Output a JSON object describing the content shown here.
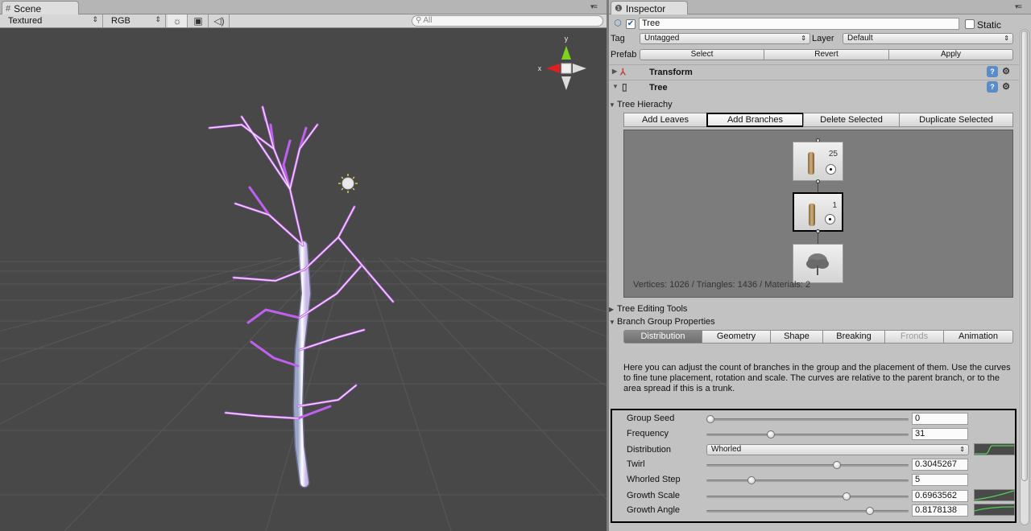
{
  "scene": {
    "tab_label": "Scene",
    "tab_icon": "grid-icon",
    "toolbar": {
      "render_mode": "Textured",
      "color_mode": "RGB",
      "search_placeholder": "All"
    }
  },
  "inspector": {
    "tab_label": "Inspector",
    "tab_icon": "info-icon",
    "object": {
      "name": "Tree",
      "active": true,
      "static_label": "Static",
      "static": false,
      "tag_label": "Tag",
      "tag_value": "Untagged",
      "layer_label": "Layer",
      "layer_value": "Default",
      "prefab_label": "Prefab",
      "prefab_buttons": [
        "Select",
        "Revert",
        "Apply"
      ]
    },
    "components": [
      {
        "name": "Transform",
        "icon": "transform-axes-icon",
        "expanded": false
      },
      {
        "name": "Tree",
        "icon": "document-icon",
        "expanded": true
      }
    ],
    "tree_hierarchy": {
      "label": "Tree Hierachy",
      "buttons": [
        "Add Leaves",
        "Add Branches",
        "Delete Selected",
        "Duplicate Selected"
      ],
      "selected_button": "Add Branches",
      "nodes": [
        {
          "count": "25",
          "kind": "branch"
        },
        {
          "count": "1",
          "kind": "branch",
          "selected": true
        },
        {
          "count": "",
          "kind": "tree-root"
        }
      ],
      "stats": "Vertices: 1026 / Triangles: 1436 / Materials: 2"
    },
    "tree_editing_tools": {
      "label": "Tree Editing Tools"
    },
    "branch_group": {
      "label": "Branch Group Properties",
      "tabs": [
        {
          "label": "Distribution",
          "active": true
        },
        {
          "label": "Geometry"
        },
        {
          "label": "Shape"
        },
        {
          "label": "Breaking"
        },
        {
          "label": "Fronds",
          "disabled": true
        },
        {
          "label": "Animation"
        }
      ],
      "help_text": "Here you can adjust the count of branches in the group and the placement of them. Use the curves to fine tune placement, rotation and scale. The curves are relative to the parent branch, or to the area spread if this is a trunk.",
      "properties": [
        {
          "label": "Group Seed",
          "value": "0",
          "slider": 0.0
        },
        {
          "label": "Frequency",
          "value": "31",
          "slider": 0.31
        },
        {
          "label": "Distribution",
          "value": "Whorled",
          "dropdown": true,
          "curve": true
        },
        {
          "label": "Twirl",
          "value": "0.3045267",
          "slider": 0.65
        },
        {
          "label": "Whorled Step",
          "value": "5",
          "slider": 0.21
        },
        {
          "label": "Growth Scale",
          "value": "0.6963562",
          "slider": 0.7,
          "curve": true
        },
        {
          "label": "Growth Angle",
          "value": "0.8178138",
          "slider": 0.82,
          "curve": true
        }
      ]
    }
  },
  "colors": {
    "scene_bg": "#484848",
    "grid": "#5a5a5a",
    "branch_highlight": "#b050e8",
    "gizmo_y": "#7ed321",
    "gizmo_x": "#e02020"
  }
}
